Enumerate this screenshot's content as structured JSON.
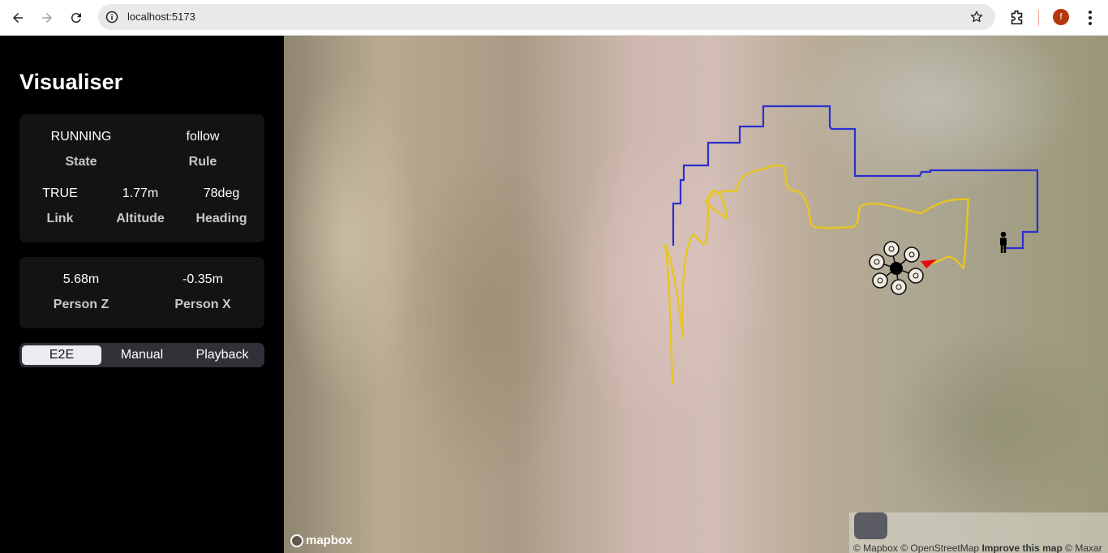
{
  "browser": {
    "url": "localhost:5173",
    "profile_initial": "f"
  },
  "sidebar": {
    "title": "Visualiser",
    "status": {
      "state": {
        "value": "RUNNING",
        "label": "State"
      },
      "rule": {
        "value": "follow",
        "label": "Rule"
      },
      "link": {
        "value": "TRUE",
        "label": "Link"
      },
      "altitude": {
        "value": "1.77m",
        "label": "Altitude"
      },
      "heading": {
        "value": "78deg",
        "label": "Heading"
      }
    },
    "person": {
      "z": {
        "value": "5.68m",
        "label": "Person Z"
      },
      "x": {
        "value": "-0.35m",
        "label": "Person X"
      }
    },
    "modes": [
      "E2E",
      "Manual",
      "Playback"
    ],
    "active_mode": "E2E"
  },
  "map": {
    "logo": "mapbox",
    "attribution": {
      "mapbox": "© Mapbox",
      "osm": "© OpenStreetMap",
      "improve": "Improve this map",
      "maxar": "© Maxar"
    },
    "colors": {
      "planned_path": "#2a2fd0",
      "drone_track": "#e8c520",
      "heading_marker": "#e01010"
    }
  }
}
